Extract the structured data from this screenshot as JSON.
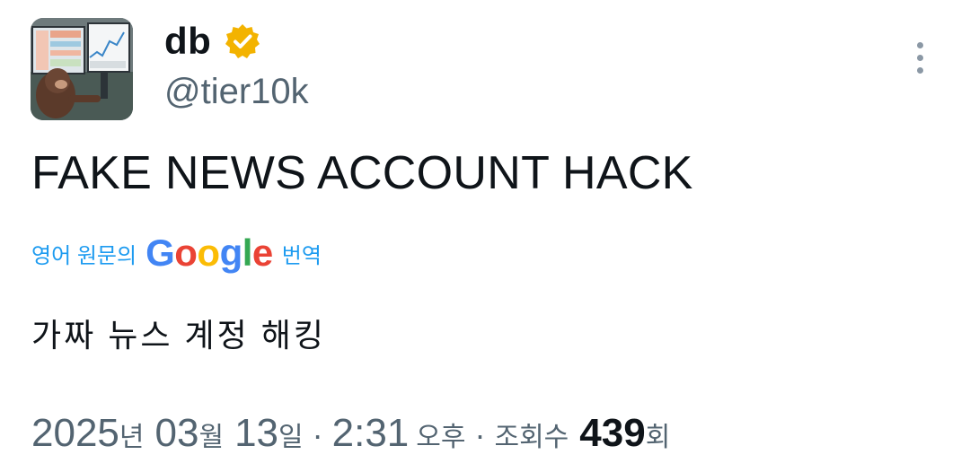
{
  "author": {
    "display_name": "db",
    "handle": "@tier10k",
    "verified_icon": "verified-gold-badge",
    "avatar_icon": "monkey-at-trading-screens"
  },
  "tweet": {
    "text": "FAKE NEWS ACCOUNT HACK",
    "translate_prefix": "영어 원문의",
    "translate_brand": "Google",
    "translate_suffix": "번역",
    "translated_text": "가짜 뉴스 계정 해킹"
  },
  "meta": {
    "year": "2025",
    "year_unit": "년",
    "month": "03",
    "month_unit": "월",
    "day": "13",
    "day_unit": "일",
    "separator": "·",
    "time": "2:31",
    "ampm": "오후",
    "views_label": "조회수",
    "views_count": "439",
    "views_unit": "회"
  },
  "colors": {
    "link": "#1d9bf0",
    "muted": "#536471",
    "verified": "#f3b300"
  }
}
